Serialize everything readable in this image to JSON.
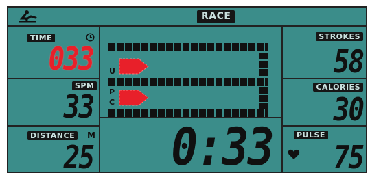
{
  "header": {
    "mode_label": "RACE",
    "rower_icon": "rower-icon"
  },
  "left": {
    "time": {
      "label": "TIME",
      "value": "033",
      "clock_icon": "clock-icon"
    },
    "spm": {
      "label": "SPM",
      "value": "33"
    },
    "distance": {
      "label": "DISTANCE",
      "unit": "M",
      "value": "25"
    }
  },
  "center": {
    "lane_user_letter": "U",
    "lane_pc_letters": [
      "P",
      "C"
    ],
    "elapsed_time": "0:33"
  },
  "right": {
    "strokes": {
      "label": "STROKES",
      "value": "58"
    },
    "calories": {
      "label": "CALORIES",
      "value": "30"
    },
    "pulse": {
      "label": "PULSE",
      "value": "75",
      "heart_icon": "heart-icon"
    }
  },
  "colors": {
    "lcd_background": "#3b8d8a",
    "segment_dark": "#101010",
    "segment_red": "#e8202a"
  }
}
